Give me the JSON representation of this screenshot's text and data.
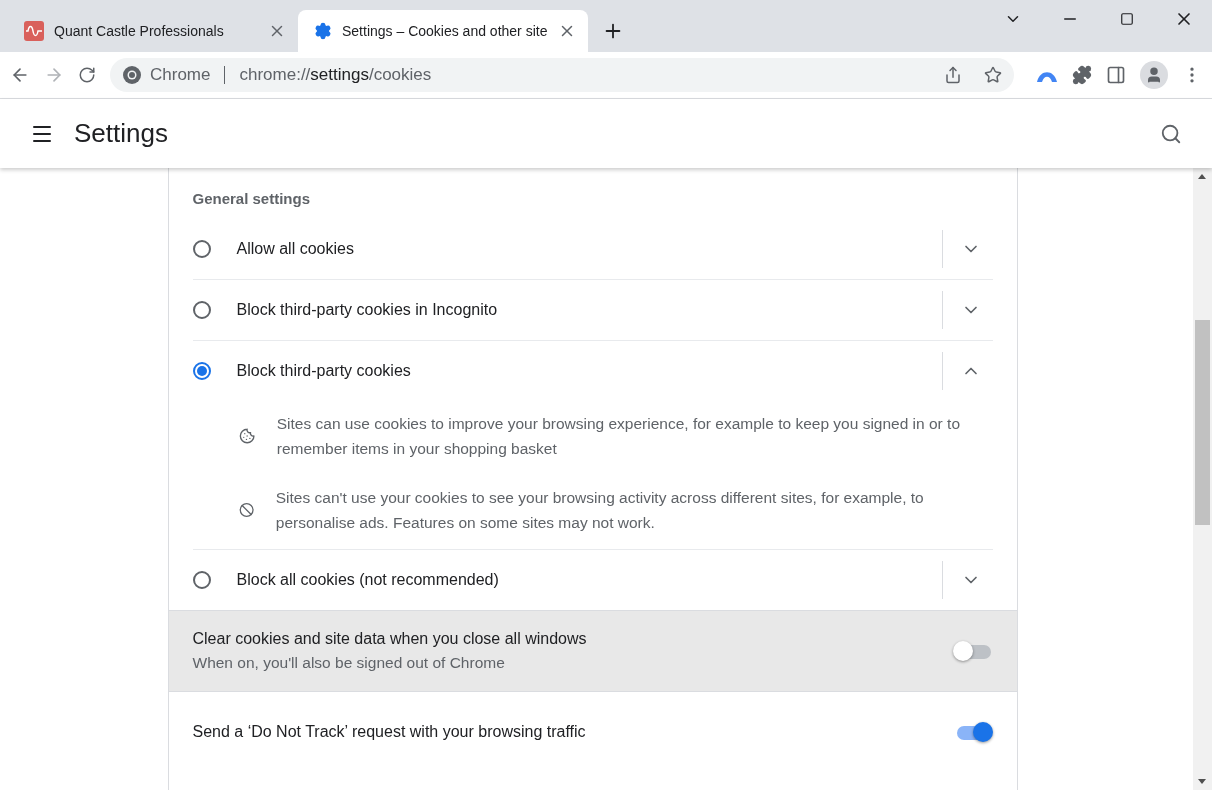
{
  "tabs": [
    {
      "title": "Quant Castle Professionals",
      "selected": false
    },
    {
      "title": "Settings – Cookies and other site",
      "selected": true
    }
  ],
  "address_bar": {
    "site_label": "Chrome",
    "url_prefix": "chrome://",
    "url_host": "settings",
    "url_path": "/cookies"
  },
  "header": {
    "title": "Settings"
  },
  "section": {
    "title": "General settings",
    "options": [
      {
        "label": "Allow all cookies",
        "selected": false,
        "expanded": false
      },
      {
        "label": "Block third-party cookies in Incognito",
        "selected": false,
        "expanded": false
      },
      {
        "label": "Block third-party cookies",
        "selected": true,
        "expanded": true,
        "details": [
          {
            "kind": "cookie",
            "text": "Sites can use cookies to improve your browsing experience, for example to keep you signed in or to remember items in your shopping basket"
          },
          {
            "kind": "block",
            "text": "Sites can't use your cookies to see your browsing activity across different sites, for example, to personalise ads. Features on some sites may not work."
          }
        ]
      },
      {
        "label": "Block all cookies (not recommended)",
        "selected": false,
        "expanded": false
      }
    ],
    "toggles": [
      {
        "label": "Clear cookies and site data when you close all windows",
        "sublabel": "When on, you'll also be signed out of Chrome",
        "on": false,
        "hovered": true
      },
      {
        "label": "Send a ‘Do Not Track’ request with your browsing traffic",
        "on": true,
        "hovered": false
      }
    ]
  }
}
